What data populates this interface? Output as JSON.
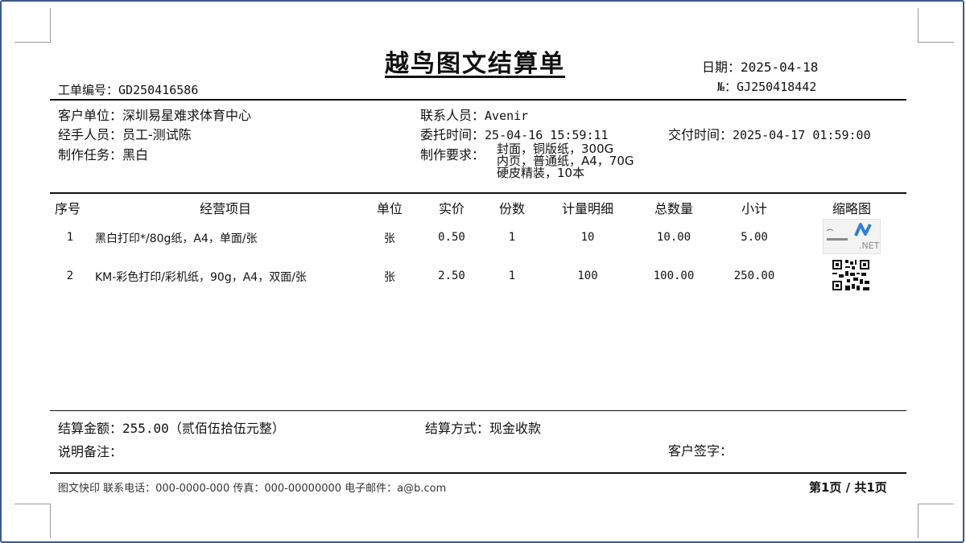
{
  "title": "越鸟图文结算单",
  "header": {
    "date_label": "日期：",
    "date_value": "2025-04-18",
    "no_label": "№：",
    "no_value": "GJ250418442",
    "order_label": "工单编号：",
    "order_value": "GD250416586"
  },
  "info": {
    "customer_label": "客户单位：",
    "customer_value": "深圳易星难求体育中心",
    "contact_label": "联系人员：",
    "contact_value": "Avenir",
    "handler_label": "经手人员：",
    "handler_value": "员工-测试陈",
    "entrust_label": "委托时间：",
    "entrust_value": "25-04-16 15:59:11",
    "deliver_label": "交付时间：",
    "deliver_value": "2025-04-17 01:59:00",
    "task_label": "制作任务：",
    "task_value": "黑白",
    "req_label": "制作要求：",
    "req_lines": [
      "封面，铜版纸，300G",
      "内页，普通纸，A4，70G",
      "硬皮精装，10本"
    ]
  },
  "table": {
    "headers": [
      "序号",
      "经营项目",
      "单位",
      "实价",
      "份数",
      "计量明细",
      "总数量",
      "小计",
      "缩略图"
    ],
    "rows": [
      [
        "1",
        "黑白打印*/80g纸，A4，单面/张",
        "张",
        "0.50",
        "1",
        "10",
        "10.00",
        "5.00"
      ],
      [
        "2",
        "KM-彩色打印/彩机纸，90g，A4，双面/张",
        "张",
        "2.50",
        "1",
        "100",
        "100.00",
        "250.00"
      ]
    ],
    "thumb1_text": ".NET"
  },
  "summary": {
    "amount_label": "结算金额：",
    "amount_value": "255.00（贰佰伍拾伍元整）",
    "method_label": "结算方式：",
    "method_value": "现金收款",
    "remark_label": "说明备注：",
    "sign_label": "客户签字："
  },
  "footer": {
    "contact_line": "图文快印 联系电话：000-0000-000 传真：000-00000000 电子邮件：a@b.com",
    "page": "第1页 / 共1页"
  }
}
